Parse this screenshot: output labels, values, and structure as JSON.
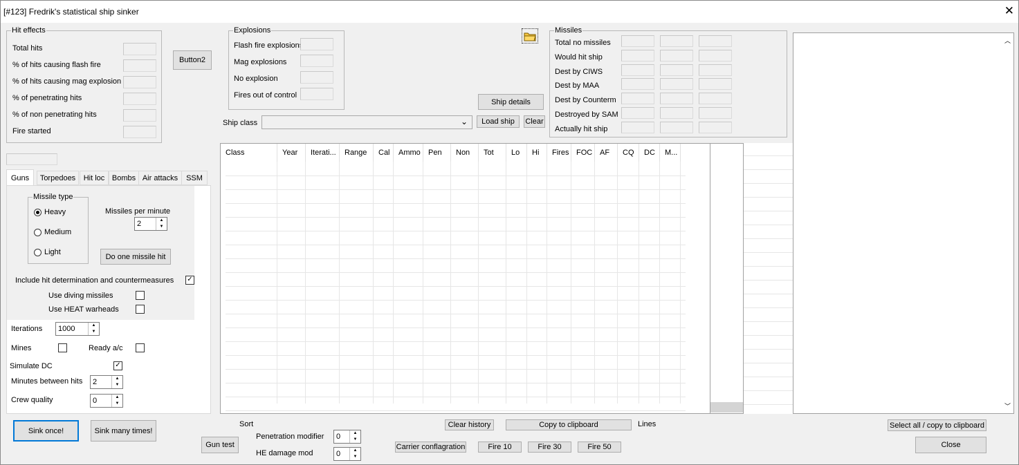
{
  "window": {
    "title": "[#123] Fredrik's statistical ship sinker",
    "close_glyph": "✕"
  },
  "hit_effects": {
    "legend": "Hit effects",
    "rows": [
      "Total hits",
      "% of hits causing flash fire",
      "% of hits causing mag explosion",
      "% of penetrating hits",
      "% of non penetrating hits",
      "Fire started"
    ]
  },
  "button2": "Button2",
  "explosions": {
    "legend": "Explosions",
    "rows": [
      "Flash fire explosions",
      "Mag explosions",
      "No explosion",
      "Fires out of control"
    ]
  },
  "folder_icon": "folder-icon",
  "missiles": {
    "legend": "Missiles",
    "rows": [
      "Total no missiles",
      "Would hit ship",
      "Dest by CIWS",
      "Dest by MAA",
      "Dest by Counterm",
      "Destroyed by SAM",
      "Actually hit ship"
    ]
  },
  "ship": {
    "details_label": "Ship details",
    "class_label": "Ship class",
    "class_value": "",
    "load_label": "Load ship",
    "clear_label": "Clear"
  },
  "tabs": [
    "Guns",
    "Torpedoes",
    "Hit loc",
    "Bombs",
    "Air attacks",
    "SSM"
  ],
  "ssm": {
    "missile_type_legend": "Missile type",
    "types": [
      "Heavy",
      "Medium",
      "Light"
    ],
    "selected_type": "Heavy",
    "missiles_per_minute_label": "Missiles per minute",
    "missiles_per_minute": "2",
    "do_one_hit_label": "Do one missile hit",
    "include_hit_label": "Include hit determination and countermeasures",
    "include_hit_checked": true,
    "diving_label": "Use diving missiles",
    "diving_checked": false,
    "heat_label": "Use HEAT warheads",
    "heat_checked": false
  },
  "settings": {
    "iterations_label": "Iterations",
    "iterations": "1000",
    "mines_label": "Mines",
    "mines_checked": false,
    "ready_ac_label": "Ready a/c",
    "ready_ac_checked": false,
    "simulate_dc_label": "Simulate DC",
    "simulate_dc_checked": true,
    "minutes_label": "Minutes between hits",
    "minutes": "2",
    "crew_label": "Crew quality",
    "crew": "0"
  },
  "grid": {
    "columns": [
      "Class",
      "Year",
      "Iterati...",
      "Range",
      "Cal",
      "Ammo",
      "Pen",
      "Non",
      "Tot",
      "Lo",
      "Hi",
      "Fires",
      "FOC",
      "AF",
      "CQ",
      "DC",
      "M..."
    ]
  },
  "bottom": {
    "sink_once": "Sink once!",
    "sink_many": "Sink many times!",
    "sort_label": "Sort",
    "gun_test": "Gun test",
    "pen_mod_label": "Penetration modifier",
    "pen_mod": "0",
    "he_mod_label": "HE damage mod",
    "he_mod": "0",
    "clear_history": "Clear history",
    "copy_clipboard": "Copy to clipboard",
    "lines_label": "Lines",
    "carrier": "Carrier conflagration",
    "fire10": "Fire 10",
    "fire30": "Fire 30",
    "fire50": "Fire 50",
    "select_all": "Select all / copy to clipboard",
    "close": "Close"
  }
}
